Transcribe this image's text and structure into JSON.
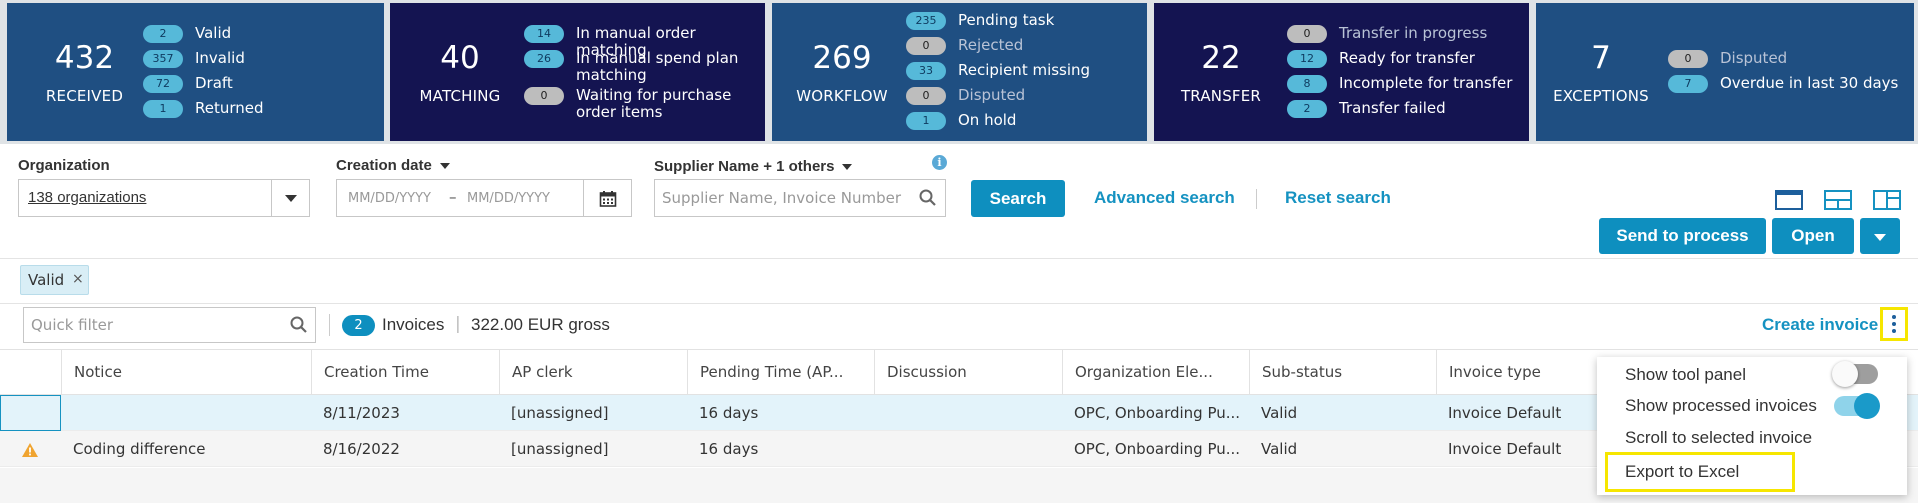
{
  "colors": {
    "tile_dark_blue": "#1f4f82",
    "tile_navy": "#141451",
    "accent": "#0e8fbf",
    "highlight": "#f6e600"
  },
  "tiles": [
    {
      "big": "432",
      "cap": "RECEIVED",
      "items": [
        {
          "count": "2",
          "label": "Valid",
          "pill": "blue"
        },
        {
          "count": "357",
          "label": "Invalid",
          "pill": "blue"
        },
        {
          "count": "72",
          "label": "Draft",
          "pill": "blue"
        },
        {
          "count": "1",
          "label": "Returned",
          "pill": "blue"
        }
      ]
    },
    {
      "big": "40",
      "cap": "MATCHING",
      "items": [
        {
          "count": "14",
          "label": "In manual order matching",
          "pill": "blue"
        },
        {
          "count": "26",
          "label": "In manual spend plan matching",
          "pill": "blue"
        },
        {
          "count": "0",
          "label": "Waiting for purchase order items",
          "pill": "gray"
        }
      ]
    },
    {
      "big": "269",
      "cap": "WORKFLOW",
      "items": [
        {
          "count": "235",
          "label": "Pending task",
          "pill": "blue"
        },
        {
          "count": "0",
          "label": "Rejected",
          "pill": "gray"
        },
        {
          "count": "33",
          "label": "Recipient missing",
          "pill": "blue"
        },
        {
          "count": "0",
          "label": "Disputed",
          "pill": "gray"
        },
        {
          "count": "1",
          "label": "On hold",
          "pill": "blue"
        }
      ]
    },
    {
      "big": "22",
      "cap": "TRANSFER",
      "items": [
        {
          "count": "0",
          "label": "Transfer in progress",
          "pill": "gray"
        },
        {
          "count": "12",
          "label": "Ready for transfer",
          "pill": "blue"
        },
        {
          "count": "8",
          "label": "Incomplete for transfer",
          "pill": "blue"
        },
        {
          "count": "2",
          "label": "Transfer failed",
          "pill": "blue"
        }
      ]
    },
    {
      "big": "7",
      "cap": "EXCEPTIONS",
      "items": [
        {
          "count": "0",
          "label": "Disputed",
          "pill": "gray"
        },
        {
          "count": "7",
          "label": "Overdue in last 30 days",
          "pill": "blue"
        }
      ]
    }
  ],
  "filters": {
    "organization_label": "Organization",
    "organization_value": "138 organizations",
    "creation_date_label": "Creation date",
    "date_from_placeholder": "MM/DD/YYYY",
    "date_sep": "–",
    "date_to_placeholder": "MM/DD/YYYY",
    "supplier_label": "Supplier Name + 1 others",
    "supplier_placeholder": "Supplier Name, Invoice Number",
    "search_button": "Search",
    "advanced_search": "Advanced search",
    "reset_search": "Reset search",
    "chip": "Valid",
    "chip_close": "×"
  },
  "actions": {
    "send_to_process": "Send to process",
    "open": "Open",
    "create_invoice": "Create invoice"
  },
  "grid_toolbar": {
    "quick_filter_placeholder": "Quick filter",
    "count": "2",
    "count_label": "Invoices",
    "sep": "|",
    "gross": "322.00 EUR gross"
  },
  "columns": [
    "Notice",
    "Creation Time",
    "AP clerk",
    "Pending Time (AP...",
    "Discussion",
    "Organization Ele...",
    "Sub-status",
    "Invoice type"
  ],
  "rows": [
    {
      "notice": "",
      "warning": false,
      "creation": "8/11/2023",
      "clerk": "[unassigned]",
      "pending": "16 days",
      "discussion": "",
      "org": "OPC, Onboarding Pu...",
      "sub": "Valid",
      "type": "Invoice Default"
    },
    {
      "notice": "Coding difference",
      "warning": true,
      "creation": "8/16/2022",
      "clerk": "[unassigned]",
      "pending": "16 days",
      "discussion": "",
      "org": "OPC, Onboarding Pu...",
      "sub": "Valid",
      "type": "Invoice Default"
    }
  ],
  "menu": {
    "show_tool_panel": "Show tool panel",
    "show_tool_panel_on": false,
    "show_processed": "Show processed invoices",
    "show_processed_on": true,
    "scroll_selected": "Scroll to selected invoice",
    "export_excel": "Export to Excel"
  }
}
